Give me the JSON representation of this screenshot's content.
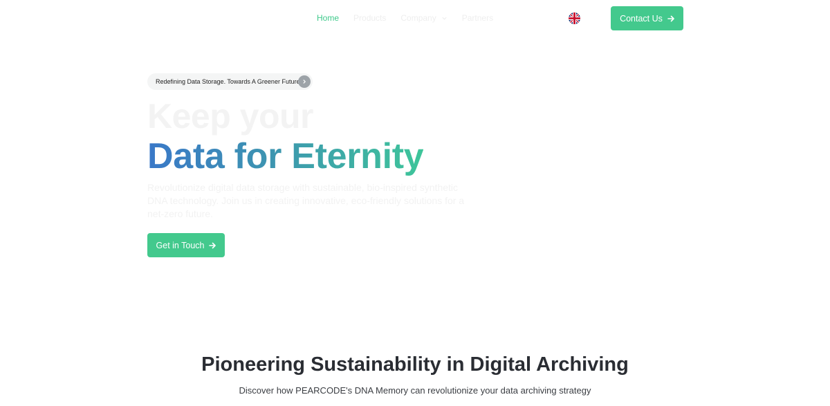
{
  "nav": {
    "items": [
      {
        "label": "Home",
        "active": true
      },
      {
        "label": "Products",
        "active": false
      },
      {
        "label": "Company",
        "active": false,
        "has_dropdown": true
      },
      {
        "label": "Partners",
        "active": false
      }
    ],
    "language_flag_icon": "uk-flag-icon",
    "contact_label": "Contact Us"
  },
  "hero": {
    "badge_text": "Redefining Data Storage. Towards A Greener Future",
    "title_line1": "Keep your",
    "title_line2": "Data for Eternity",
    "description": "Revolutionize digital data storage with sustainable, bio-inspired synthetic DNA technology. Join us in creating innovative, eco-friendly solutions for a net-zero future.",
    "cta_label": "Get in Touch"
  },
  "section": {
    "title": "Pioneering Sustainability in Digital Archiving",
    "subtitle": "Discover how PEARCODE's DNA Memory can revolutionize your data archiving strategy"
  },
  "colors": {
    "accent": "#43c98d",
    "gradient_start": "#3a78c8",
    "gradient_end": "#3ec59a"
  }
}
